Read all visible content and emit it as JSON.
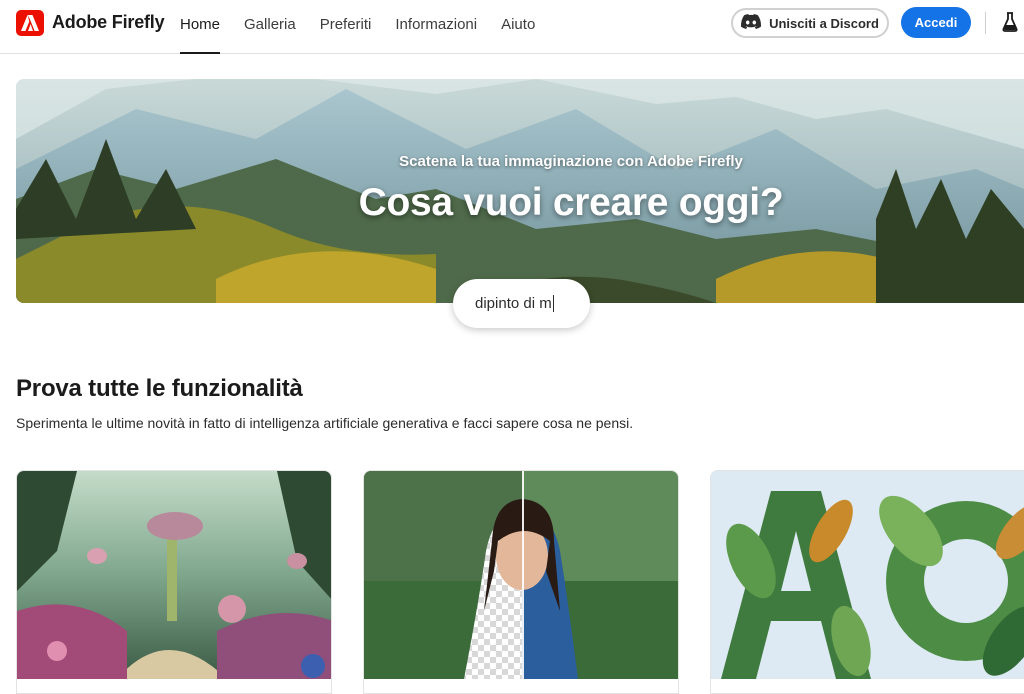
{
  "header": {
    "brand": "Adobe Firefly",
    "logo_icon": "adobe-logo-icon",
    "nav": [
      {
        "label": "Home",
        "active": true
      },
      {
        "label": "Galleria",
        "active": false
      },
      {
        "label": "Preferiti",
        "active": false
      },
      {
        "label": "Informazioni",
        "active": false
      },
      {
        "label": "Aiuto",
        "active": false
      }
    ],
    "discord_label": "Unisciti a Discord",
    "discord_icon": "discord-icon",
    "signin_label": "Accedi",
    "labs_icon": "flask-icon"
  },
  "hero": {
    "subtitle": "Scatena la tua immaginazione con Adobe Firefly",
    "title": "Cosa vuoi creare oggi?",
    "prompt_value": "dipinto di m"
  },
  "features": {
    "title": "Prova tutte le funzionalità",
    "description": "Sperimenta le ultime novità in fatto di intelligenza artificiale generativa e facci sapere cosa ne pensi.",
    "cards": [
      {
        "name": "fantasy-garden-image"
      },
      {
        "name": "woman-background-removal-image"
      },
      {
        "name": "leaf-text-effects-image"
      }
    ]
  },
  "colors": {
    "accent": "#1473e6",
    "brand_red": "#eb1000"
  }
}
